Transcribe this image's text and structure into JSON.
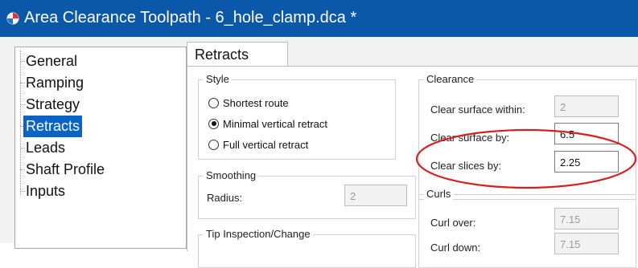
{
  "window": {
    "title": "Area Clearance Toolpath - 6_hole_clamp.dca *"
  },
  "tree": {
    "items": [
      {
        "label": "General",
        "selected": false
      },
      {
        "label": "Ramping",
        "selected": false
      },
      {
        "label": "Strategy",
        "selected": false
      },
      {
        "label": "Retracts",
        "selected": true
      },
      {
        "label": "Leads",
        "selected": false
      },
      {
        "label": "Shaft Profile",
        "selected": false
      },
      {
        "label": "Inputs",
        "selected": false
      }
    ]
  },
  "tab": {
    "label": "Retracts"
  },
  "style_group": {
    "title": "Style",
    "options": [
      {
        "label": "Shortest route",
        "checked": false
      },
      {
        "label": "Minimal vertical retract",
        "checked": true
      },
      {
        "label": "Full vertical retract",
        "checked": false
      }
    ]
  },
  "smoothing_group": {
    "title": "Smoothing",
    "radius_label": "Radius:",
    "radius_value": "2"
  },
  "tip_group": {
    "title": "Tip Inspection/Change"
  },
  "clearance_group": {
    "title": "Clearance",
    "within_label": "Clear surface within:",
    "within_value": "2",
    "by_label": "Clear surface by:",
    "by_value": "6.5",
    "slices_label": "Clear slices by:",
    "slices_value": "2.25"
  },
  "curls_group": {
    "title": "Curls",
    "over_label": "Curl over:",
    "over_value": "7.15",
    "down_label": "Curl down:",
    "down_value": "7.15"
  },
  "colors": {
    "titlebar": "#0b58ab",
    "selection": "#0a64c8",
    "highlight_ellipse": "#d42020"
  }
}
